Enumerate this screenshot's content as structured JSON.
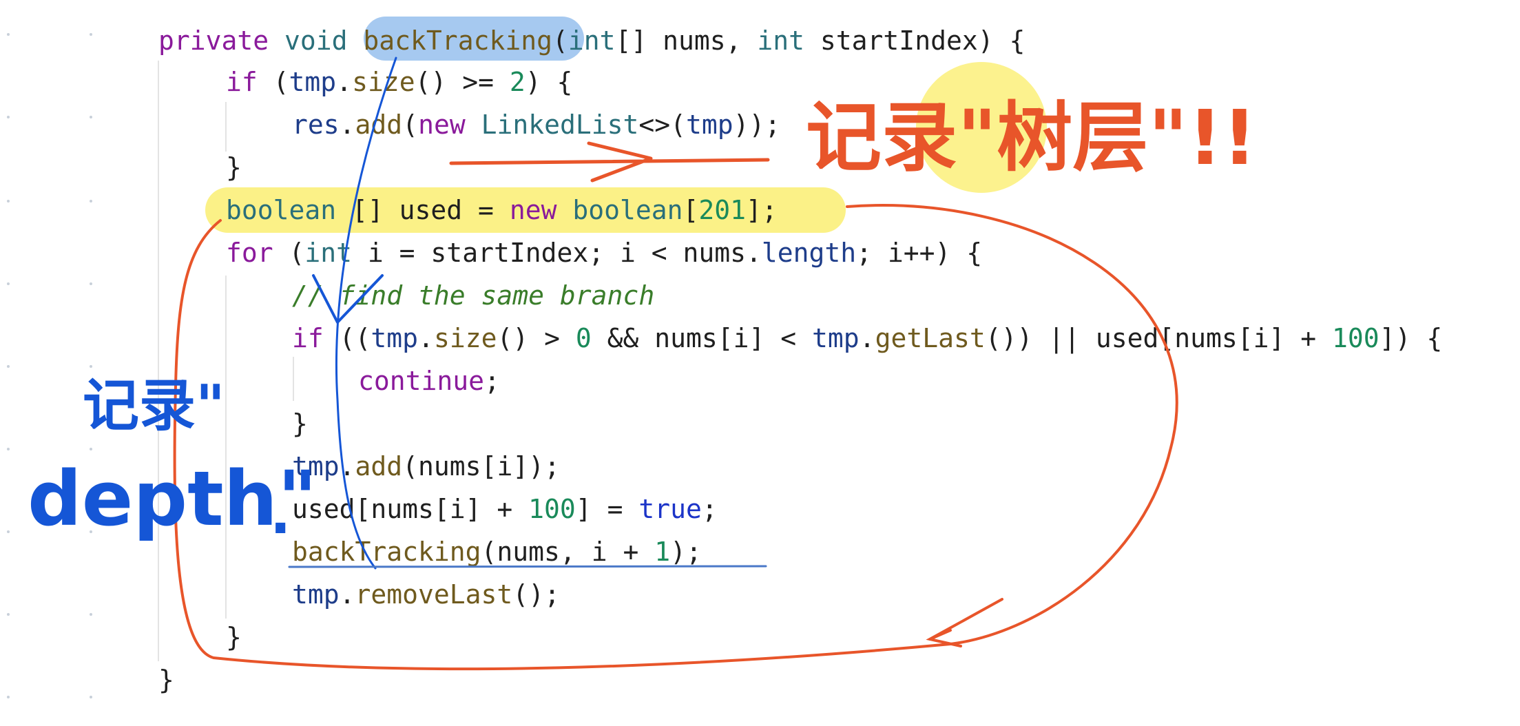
{
  "code_lines": [
    {
      "tokens": [
        {
          "t": "private ",
          "c": "k-purple"
        },
        {
          "t": "void ",
          "c": "k-teal"
        },
        {
          "t": "backTracking",
          "c": "k-method"
        },
        {
          "t": "(",
          "c": "k-plain"
        },
        {
          "t": "int",
          "c": "k-teal"
        },
        {
          "t": "[] nums, ",
          "c": "k-plain"
        },
        {
          "t": "int ",
          "c": "k-teal"
        },
        {
          "t": "startIndex) {",
          "c": "k-plain"
        }
      ]
    },
    {
      "tokens": [
        {
          "t": "if ",
          "c": "k-purple"
        },
        {
          "t": "(",
          "c": "k-plain"
        },
        {
          "t": "tmp",
          "c": "k-field"
        },
        {
          "t": ".",
          "c": "k-plain"
        },
        {
          "t": "size",
          "c": "k-method"
        },
        {
          "t": "() >= ",
          "c": "k-plain"
        },
        {
          "t": "2",
          "c": "k-num"
        },
        {
          "t": ") {",
          "c": "k-plain"
        }
      ]
    },
    {
      "tokens": [
        {
          "t": "res",
          "c": "k-field"
        },
        {
          "t": ".",
          "c": "k-plain"
        },
        {
          "t": "add",
          "c": "k-method"
        },
        {
          "t": "(",
          "c": "k-plain"
        },
        {
          "t": "new ",
          "c": "k-purple"
        },
        {
          "t": "LinkedList",
          "c": "k-teal"
        },
        {
          "t": "<>(",
          "c": "k-plain"
        },
        {
          "t": "tmp",
          "c": "k-field"
        },
        {
          "t": "));",
          "c": "k-plain"
        }
      ]
    },
    {
      "tokens": [
        {
          "t": "}",
          "c": "k-plain"
        }
      ]
    },
    {
      "tokens": [
        {
          "t": "boolean ",
          "c": "k-teal"
        },
        {
          "t": "[] used = ",
          "c": "k-plain"
        },
        {
          "t": "new ",
          "c": "k-purple"
        },
        {
          "t": "boolean",
          "c": "k-teal"
        },
        {
          "t": "[",
          "c": "k-plain"
        },
        {
          "t": "201",
          "c": "k-num"
        },
        {
          "t": "];",
          "c": "k-plain"
        }
      ]
    },
    {
      "tokens": [
        {
          "t": "for ",
          "c": "k-purple"
        },
        {
          "t": "(",
          "c": "k-plain"
        },
        {
          "t": "int ",
          "c": "k-teal"
        },
        {
          "t": "i = startIndex; i < nums.",
          "c": "k-plain"
        },
        {
          "t": "length",
          "c": "k-field"
        },
        {
          "t": "; i++) {",
          "c": "k-plain"
        }
      ]
    },
    {
      "tokens": [
        {
          "t": "// find the same branch",
          "c": "k-comment"
        }
      ]
    },
    {
      "tokens": [
        {
          "t": "if ",
          "c": "k-purple"
        },
        {
          "t": "((",
          "c": "k-plain"
        },
        {
          "t": "tmp",
          "c": "k-field"
        },
        {
          "t": ".",
          "c": "k-plain"
        },
        {
          "t": "size",
          "c": "k-method"
        },
        {
          "t": "() > ",
          "c": "k-plain"
        },
        {
          "t": "0",
          "c": "k-num"
        },
        {
          "t": " && nums[i] < ",
          "c": "k-plain"
        },
        {
          "t": "tmp",
          "c": "k-field"
        },
        {
          "t": ".",
          "c": "k-plain"
        },
        {
          "t": "getLast",
          "c": "k-method"
        },
        {
          "t": "()) || used[nums[i] + ",
          "c": "k-plain"
        },
        {
          "t": "100",
          "c": "k-num"
        },
        {
          "t": "]) {",
          "c": "k-plain"
        }
      ]
    },
    {
      "tokens": [
        {
          "t": "continue",
          "c": "k-purple"
        },
        {
          "t": ";",
          "c": "k-plain"
        }
      ]
    },
    {
      "tokens": [
        {
          "t": "}",
          "c": "k-plain"
        }
      ]
    },
    {
      "tokens": [
        {
          "t": "tmp",
          "c": "k-field"
        },
        {
          "t": ".",
          "c": "k-plain"
        },
        {
          "t": "add",
          "c": "k-method"
        },
        {
          "t": "(nums[i]);",
          "c": "k-plain"
        }
      ]
    },
    {
      "tokens": [
        {
          "t": "used[nums[i] + ",
          "c": "k-plain"
        },
        {
          "t": "100",
          "c": "k-num"
        },
        {
          "t": "] = ",
          "c": "k-plain"
        },
        {
          "t": "true",
          "c": "k-true"
        },
        {
          "t": ";",
          "c": "k-plain"
        }
      ]
    },
    {
      "tokens": [
        {
          "t": "backTracking",
          "c": "k-method"
        },
        {
          "t": "(nums, i + ",
          "c": "k-plain"
        },
        {
          "t": "1",
          "c": "k-num"
        },
        {
          "t": ");",
          "c": "k-plain"
        }
      ]
    },
    {
      "tokens": [
        {
          "t": "tmp",
          "c": "k-field"
        },
        {
          "t": ".",
          "c": "k-plain"
        },
        {
          "t": "removeLast",
          "c": "k-method"
        },
        {
          "t": "();",
          "c": "k-plain"
        }
      ]
    },
    {
      "tokens": [
        {
          "t": "}",
          "c": "k-plain"
        }
      ]
    },
    {
      "tokens": [
        {
          "t": "}",
          "c": "k-plain"
        }
      ]
    }
  ],
  "annotations": {
    "blue_note_line1": "记录\"",
    "blue_note_line2": "depth\"",
    "blue_note_dot": ".",
    "orange_note": "记录\"树层\"!!"
  },
  "colors": {
    "blue_ink": "#1556d6",
    "orange_ink": "#e8552a",
    "yellow_highlight": "#fbf07a",
    "blue_highlight": "#9cc3ee",
    "underline_blue": "#4a78c8"
  }
}
